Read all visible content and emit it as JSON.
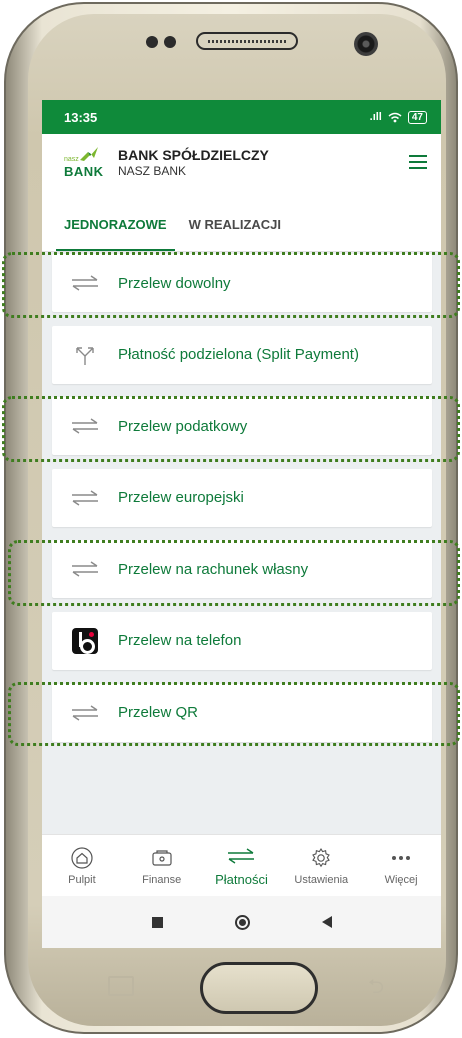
{
  "status_bar": {
    "time": "13:35",
    "signal": ".ıll",
    "wifi": "wifi",
    "battery": "47"
  },
  "header": {
    "logo_small": "nasz",
    "logo_big": "BANK",
    "bank_title": "BANK SPÓŁDZIELCZY",
    "bank_subtitle": "NASZ BANK",
    "menu_icon": "hamburger-menu-icon"
  },
  "tabs": [
    {
      "label": "JEDNORAZOWE",
      "active": true
    },
    {
      "label": "W REALIZACJI",
      "active": false
    }
  ],
  "payments": [
    {
      "label": "Przelew dowolny",
      "icon": "transfer-arrows-icon"
    },
    {
      "label": "Płatność podzielona (Split Payment)",
      "icon": "split-arrows-icon"
    },
    {
      "label": "Przelew podatkowy",
      "icon": "transfer-arrows-icon"
    },
    {
      "label": "Przelew europejski",
      "icon": "transfer-arrows-icon"
    },
    {
      "label": "Przelew na rachunek własny",
      "icon": "transfer-arrows-icon"
    },
    {
      "label": "Przelew na telefon",
      "icon": "blik-icon"
    },
    {
      "label": "Przelew QR",
      "icon": "transfer-arrows-icon"
    }
  ],
  "bottom_nav": [
    {
      "label": "Pulpit",
      "icon": "home-icon",
      "active": false
    },
    {
      "label": "Finanse",
      "icon": "wallet-icon",
      "active": false
    },
    {
      "label": "Płatności",
      "icon": "transfer-arrows-icon",
      "active": true
    },
    {
      "label": "Ustawienia",
      "icon": "gear-icon",
      "active": false
    },
    {
      "label": "Więcej",
      "icon": "more-dots-icon",
      "active": false
    }
  ],
  "colors": {
    "brand_green": "#0e7a3a",
    "status_bar": "#0f8a3a",
    "highlight": "#3f7d1f"
  }
}
